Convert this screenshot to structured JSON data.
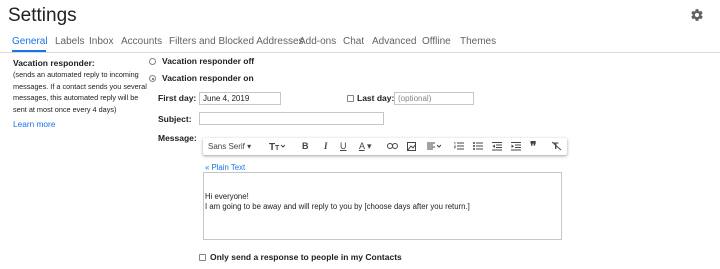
{
  "header": {
    "title": "Settings",
    "settings_icon": "gear-icon"
  },
  "tabs": [
    {
      "label": "General",
      "active": true
    },
    {
      "label": "Labels"
    },
    {
      "label": "Inbox"
    },
    {
      "label": "Accounts"
    },
    {
      "label": "Filters and Blocked Addresses"
    },
    {
      "label": "Add-ons"
    },
    {
      "label": "Chat"
    },
    {
      "label": "Advanced"
    },
    {
      "label": "Offline"
    },
    {
      "label": "Themes"
    }
  ],
  "vacation": {
    "label": "Vacation responder:",
    "desc": "(sends an automated reply to incoming messages. If a contact sends you several messages, this automated reply will be sent at most once every 4 days)",
    "learn_more": "Learn more",
    "off_label": "Vacation responder off",
    "on_label": "Vacation responder on",
    "selected": "on",
    "first_day_label": "First day:",
    "first_day_value": "June 4, 2019",
    "last_day_label": "Last day:",
    "last_day_placeholder": "(optional)",
    "last_day_checked": false,
    "subject_label": "Subject:",
    "subject_value": "",
    "message_label": "Message:",
    "toolbar": {
      "font": "Sans Serif",
      "icons": [
        "font-size-icon",
        "bold-icon",
        "italic-icon",
        "underline-icon",
        "text-color-icon",
        "link-icon",
        "image-icon",
        "align-icon",
        "numbered-list-icon",
        "bulleted-list-icon",
        "indent-less-icon",
        "indent-more-icon",
        "quote-icon",
        "remove-formatting-icon"
      ]
    },
    "plain_text_link": "« Plain Text",
    "message_line1": "Hi everyone!",
    "message_line2": "I am going to be away and will reply to you by [choose days after you return.]",
    "contacts_only_label": "Only send a response to people in my Contacts",
    "contacts_only_checked": false
  },
  "colors": {
    "accent": "#1a73e8",
    "text": "#202124",
    "muted": "#5f6368",
    "border": "#dadce0"
  }
}
